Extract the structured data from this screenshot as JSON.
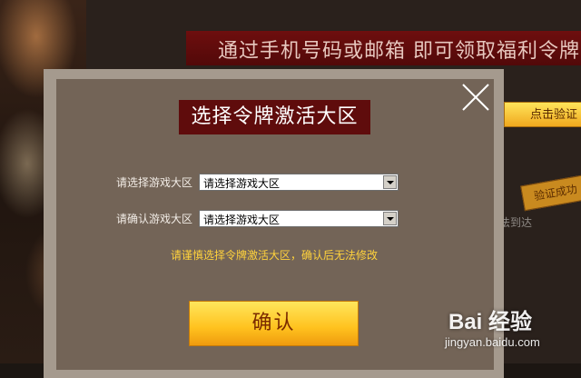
{
  "background": {
    "banner_text": "通过手机号码或邮箱 即可领取福利令牌",
    "verify_button": "点击验证",
    "verified_badge": "验证成功",
    "unreachable_text": "法到达"
  },
  "modal": {
    "title": "选择令牌激活大区",
    "fields": [
      {
        "label": "请选择游戏大区",
        "value": "请选择游戏大区"
      },
      {
        "label": "请确认游戏大区",
        "value": "请选择游戏大区"
      }
    ],
    "warning": "请谨慎选择令牌激活大区，确认后无法修改",
    "confirm_label": "确认"
  },
  "watermark": {
    "logo": "Bai 经验",
    "url": "jingyan.baidu.com"
  },
  "colors": {
    "modal_frame": "#a59a8e",
    "modal_body": "#736457",
    "title_bg": "#5f0c0c",
    "warning": "#ffd23c",
    "confirm_gradient_top": "#ffe65c",
    "confirm_gradient_bottom": "#ef9a0e"
  }
}
